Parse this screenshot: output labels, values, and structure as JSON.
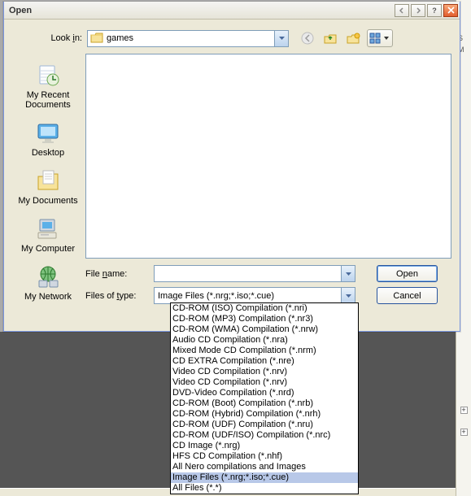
{
  "title": "Open",
  "lookin": {
    "label": "Look in:",
    "current_folder": "games",
    "nav_icons": [
      "back-icon",
      "up-icon",
      "new-folder-icon",
      "views-icon"
    ]
  },
  "places": [
    {
      "name": "recent",
      "label": "My Recent\nDocuments"
    },
    {
      "name": "desktop",
      "label": "Desktop"
    },
    {
      "name": "mydocs",
      "label": "My Documents"
    },
    {
      "name": "mycomputer",
      "label": "My Computer"
    },
    {
      "name": "mynetwork",
      "label": "My Network"
    }
  ],
  "filename": {
    "label": "File name:",
    "value": ""
  },
  "filetype": {
    "label": "Files of type:",
    "selected": "Image Files (*.nrg;*.iso;*.cue)",
    "options": [
      "CD-ROM (ISO) Compilation (*.nri)",
      "CD-ROM (MP3) Compilation (*.nr3)",
      "CD-ROM (WMA) Compilation (*.nrw)",
      "Audio CD Compilation (*.nra)",
      "Mixed Mode CD Compilation (*.nrm)",
      "CD EXTRA Compilation (*.nre)",
      "Video CD Compilation (*.nrv)",
      "Video CD Compilation (*.nrv)",
      "DVD-Video Compilation (*.nrd)",
      "CD-ROM (Boot) Compilation (*.nrb)",
      "CD-ROM (Hybrid) Compilation (*.nrh)",
      "CD-ROM (UDF) Compilation (*.nru)",
      "CD-ROM (UDF/ISO) Compilation (*.nrc)",
      "CD Image (*.nrg)",
      "HFS CD Compilation (*.nhf)",
      "All Nero compilations and Images",
      "Image Files (*.nrg;*.iso;*.cue)",
      "All Files (*.*)"
    ],
    "highlighted_index": 16
  },
  "buttons": {
    "open": "Open",
    "cancel": "Cancel"
  }
}
